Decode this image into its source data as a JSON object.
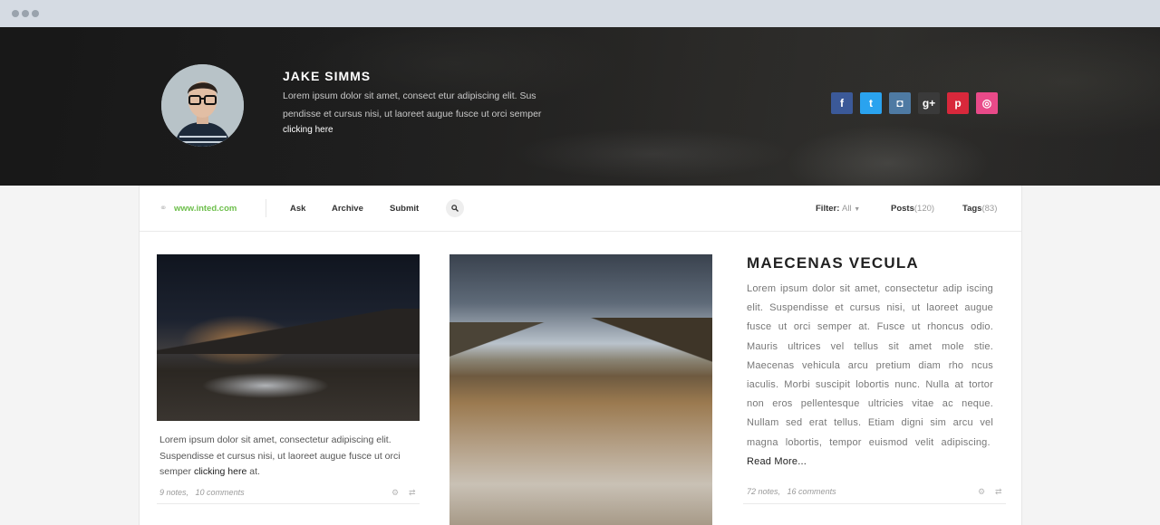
{
  "profile": {
    "name": "JAKE SIMMS",
    "bio": "Lorem ipsum dolor sit amet, consect etur adipiscing elit. Sus pendisse et cursus nisi, ut laoreet augue fusce ut orci semper",
    "link": "clicking here"
  },
  "socials": [
    {
      "name": "facebook-icon",
      "glyph": "f",
      "color": "#3b5998"
    },
    {
      "name": "twitter-icon",
      "glyph": "t",
      "color": "#2aa3ef"
    },
    {
      "name": "instagram-icon",
      "glyph": "◘",
      "color": "#4e7aa3"
    },
    {
      "name": "google-plus-icon",
      "glyph": "g+",
      "color": "#3a3a3a"
    },
    {
      "name": "pinterest-icon",
      "glyph": "p",
      "color": "#d8283b"
    },
    {
      "name": "dribbble-icon",
      "glyph": "◎",
      "color": "#e94a89"
    }
  ],
  "nav": {
    "site": "www.inted.com",
    "ask": "Ask",
    "archive": "Archive",
    "submit": "Submit",
    "filter_label": "Filter:",
    "filter_value": "All",
    "posts_label": "Posts",
    "posts_count": "(120)",
    "tags_label": "Tags",
    "tags_count": "(83)"
  },
  "cards": [
    {
      "text_before": "Lorem ipsum dolor sit amet, consectetur adipiscing elit. Suspendisse et cursus nisi, ut laoreet augue fusce ut orci semper ",
      "link": "clicking here",
      "text_after": " at.",
      "notes": "9 notes,",
      "comments": "10 comments"
    },
    {
      "title": "MAECENAS VECULA",
      "body": "Lorem ipsum dolor sit amet, consectetur adip iscing elit. Suspendisse et cursus nisi, ut laoreet augue fusce ut orci semper at. Fusce ut rhoncus odio. Mauris ultrices vel tellus sit amet mole stie. Maecenas vehicula arcu pretium diam rho ncus iaculis. Morbi suscipit lobortis nunc. Nulla at tortor non eros pellentesque ultricies vitae ac neque. Nullam sed erat tellus. Etiam digni sim arcu vel magna lobortis, tempor euismod velit adipiscing.",
      "read_more": "Read More...",
      "notes": "72 notes,",
      "comments": "16 comments"
    }
  ]
}
